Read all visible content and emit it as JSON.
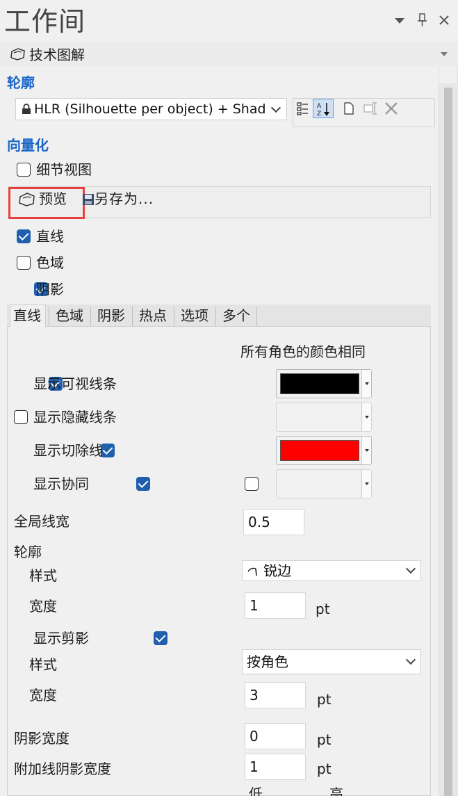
{
  "header": {
    "title": "工作间",
    "icons": [
      "dropdown-arrow-icon",
      "pin-icon",
      "close-icon"
    ]
  },
  "section": {
    "title": "技术图解"
  },
  "outline": {
    "heading": "轮廓",
    "mode_value": "HLR (Silhouette per object) + Shad"
  },
  "vectorize": {
    "heading": "向量化",
    "detail_view_label": "细节视图",
    "preview_label": "预览",
    "save_as_label": "另存为...",
    "lines_label": "直线",
    "regions_label": "色域",
    "shadow_label": "阴影"
  },
  "tabs": [
    "直线",
    "色域",
    "阴影",
    "热点",
    "选项",
    "多个"
  ],
  "lines_panel": {
    "same_color_header": "所有角色的颜色相同",
    "rows": [
      {
        "label": "显示可视线条",
        "checked": true,
        "same_checked": true,
        "same_state": "checked",
        "color": "#000000"
      },
      {
        "label": "显示隐藏线条",
        "checked": false,
        "same_checked": true,
        "same_state": "disabled",
        "color": ""
      },
      {
        "label": "显示切除线",
        "checked": true,
        "same_checked": true,
        "same_state": "checked",
        "color": "#ff0000"
      },
      {
        "label": "显示协同",
        "checked": true,
        "same_checked": false,
        "same_state": "unchecked",
        "color": ""
      }
    ],
    "global_width_label": "全局线宽",
    "global_width_value": "0.5",
    "contour_label": "轮廓",
    "contour_style_label": "样式",
    "contour_style_value": "锐边",
    "contour_width_label": "宽度",
    "contour_width_value": "1",
    "contour_width_unit": "pt",
    "show_clip_label": "显示剪影",
    "clip_style_label": "样式",
    "clip_style_value": "按角色",
    "clip_width_label": "宽度",
    "clip_width_value": "3",
    "clip_width_unit": "pt",
    "shadow_width_label": "阴影宽度",
    "shadow_width_value": "0",
    "shadow_width_unit": "pt",
    "extra_shadow_label": "附加线阴影宽度",
    "extra_shadow_value": "1",
    "extra_shadow_unit": "pt",
    "low_label": "低",
    "high_label": "高"
  },
  "colors": {
    "accent": "#1a66c8",
    "checkbox": "#1f5fae",
    "highlight_box": "#e8413b"
  }
}
